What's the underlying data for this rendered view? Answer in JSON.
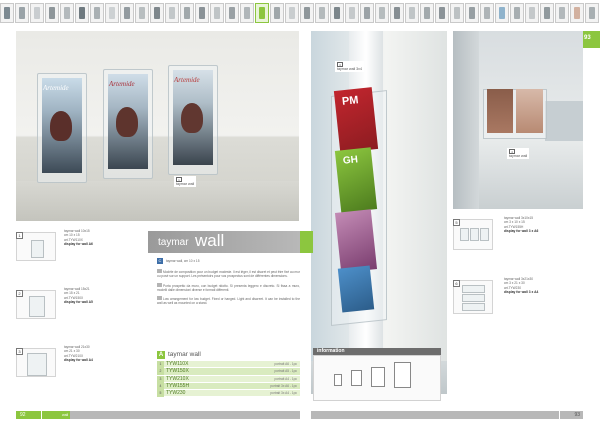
{
  "thumbnails": [
    {
      "c": "#7d8a92"
    },
    {
      "c": "#9aa3a8"
    },
    {
      "c": "#c9cdd0"
    },
    {
      "c": "#8e969a"
    },
    {
      "c": "#b3b9bc"
    },
    {
      "c": "#6f7a80"
    },
    {
      "c": "#a9b0b3"
    },
    {
      "c": "#cdd1d3"
    },
    {
      "c": "#939ba0"
    },
    {
      "c": "#b8bec0"
    },
    {
      "c": "#7e878c"
    },
    {
      "c": "#c2c7c9"
    },
    {
      "c": "#a1a8ab"
    },
    {
      "c": "#8a9297"
    },
    {
      "c": "#bfc4c6"
    },
    {
      "c": "#9aa1a5"
    },
    {
      "c": "#b0b6b9"
    },
    {
      "c": "#8cc63f"
    },
    {
      "c": "#a0a7aa"
    },
    {
      "c": "#c9cdcf"
    },
    {
      "c": "#8f979b"
    },
    {
      "c": "#b4babc"
    },
    {
      "c": "#7c868b"
    },
    {
      "c": "#c5c9cb"
    },
    {
      "c": "#9ca3a7"
    },
    {
      "c": "#b6bcbe"
    },
    {
      "c": "#868e93"
    },
    {
      "c": "#c0c5c7"
    },
    {
      "c": "#a3aaad"
    },
    {
      "c": "#8b9398"
    },
    {
      "c": "#bcc1c3"
    },
    {
      "c": "#979fa3"
    },
    {
      "c": "#aeb4b7"
    },
    {
      "c": "#8fb3cc"
    },
    {
      "c": "#a7aeb1"
    },
    {
      "c": "#c4c8ca"
    },
    {
      "c": "#919a9e"
    },
    {
      "c": "#b2b8bb"
    },
    {
      "c": "#d2b1a0"
    },
    {
      "c": "#a8afb2"
    }
  ],
  "selected_thumb": 17,
  "page_tab": "93",
  "colors": {
    "accent": "#8cc63f",
    "grey": "#a8a8a8",
    "dark": "#6d6d6d"
  },
  "photo_left_caption": {
    "num": "1",
    "text": "taymar wall"
  },
  "photo_mid_caption": {
    "num": "3",
    "text": "taymar wall 3x4"
  },
  "photo_right_caption": {
    "num": "4",
    "text": "taymar wall"
  },
  "title": {
    "word1": "taymar",
    "word2": "wall"
  },
  "intro_line": "taymar wall, cm 10 x 15",
  "paragraphs": [
    "Modèle de composition pour un budget modeste. Il est léger, il est discret et peut être fixé au mur ou posé sur un support. Les présentoirs pour vos prospectus sont de différentes dimensions.",
    "Porta prospetto da muro, con budget ridotto. Si presenta leggero e discreto. Si fissa a muro, modelli dalle dimensioni diverse e formati differenti.",
    "Low arrangement for low budget. Fixed or hanged. Light and discreet. It can be installed to the wall as well as mounted on a stand."
  ],
  "left_products": [
    {
      "num": "1",
      "lines": [
        "taymar wall 10x15",
        "cm 10 x 15",
        "art.TYW110X"
      ],
      "bold": "display for wall A6"
    },
    {
      "num": "2",
      "lines": [
        "taymar wall 15x21",
        "cm 15 x 21",
        "art.TYW150X"
      ],
      "bold": "display for wall A5"
    },
    {
      "num": "3",
      "lines": [
        "taymar wall 21x30",
        "cm 21 x 30",
        "art.TYW210X"
      ],
      "bold": "display for wall A4"
    }
  ],
  "right_products": [
    {
      "num": "5",
      "lines": [
        "taymar wall 3x10x15",
        "cm 3 x 10 x 15",
        "art.TYW155H"
      ],
      "bold": "display for wall 3 x A6"
    },
    {
      "num": "6",
      "lines": [
        "taymar wall 3x21x30",
        "cm 3 x 21 x 30",
        "art.TYW230"
      ],
      "bold": "display for wall 3 x A4"
    }
  ],
  "table": {
    "label": "A",
    "heading": "taymar wall",
    "rows": [
      {
        "n": "1",
        "code": "TYW110X",
        "desc": "portrait A6 - 1pc"
      },
      {
        "n": "2",
        "code": "TYW150X",
        "desc": "portrait A5 - 1pc"
      },
      {
        "n": "3",
        "code": "TYW210X",
        "desc": "portrait A4 - 1pc"
      },
      {
        "n": "4",
        "code": "TYW155H",
        "desc": "portrait 3x A6 - 1pc"
      },
      {
        "n": "5",
        "code": "TYW230",
        "desc": "portrait 3x A4 - 1pc"
      }
    ]
  },
  "info": {
    "heading": "information"
  },
  "footer": {
    "left_page": "92",
    "left_section": "wall",
    "right_page": "93"
  }
}
